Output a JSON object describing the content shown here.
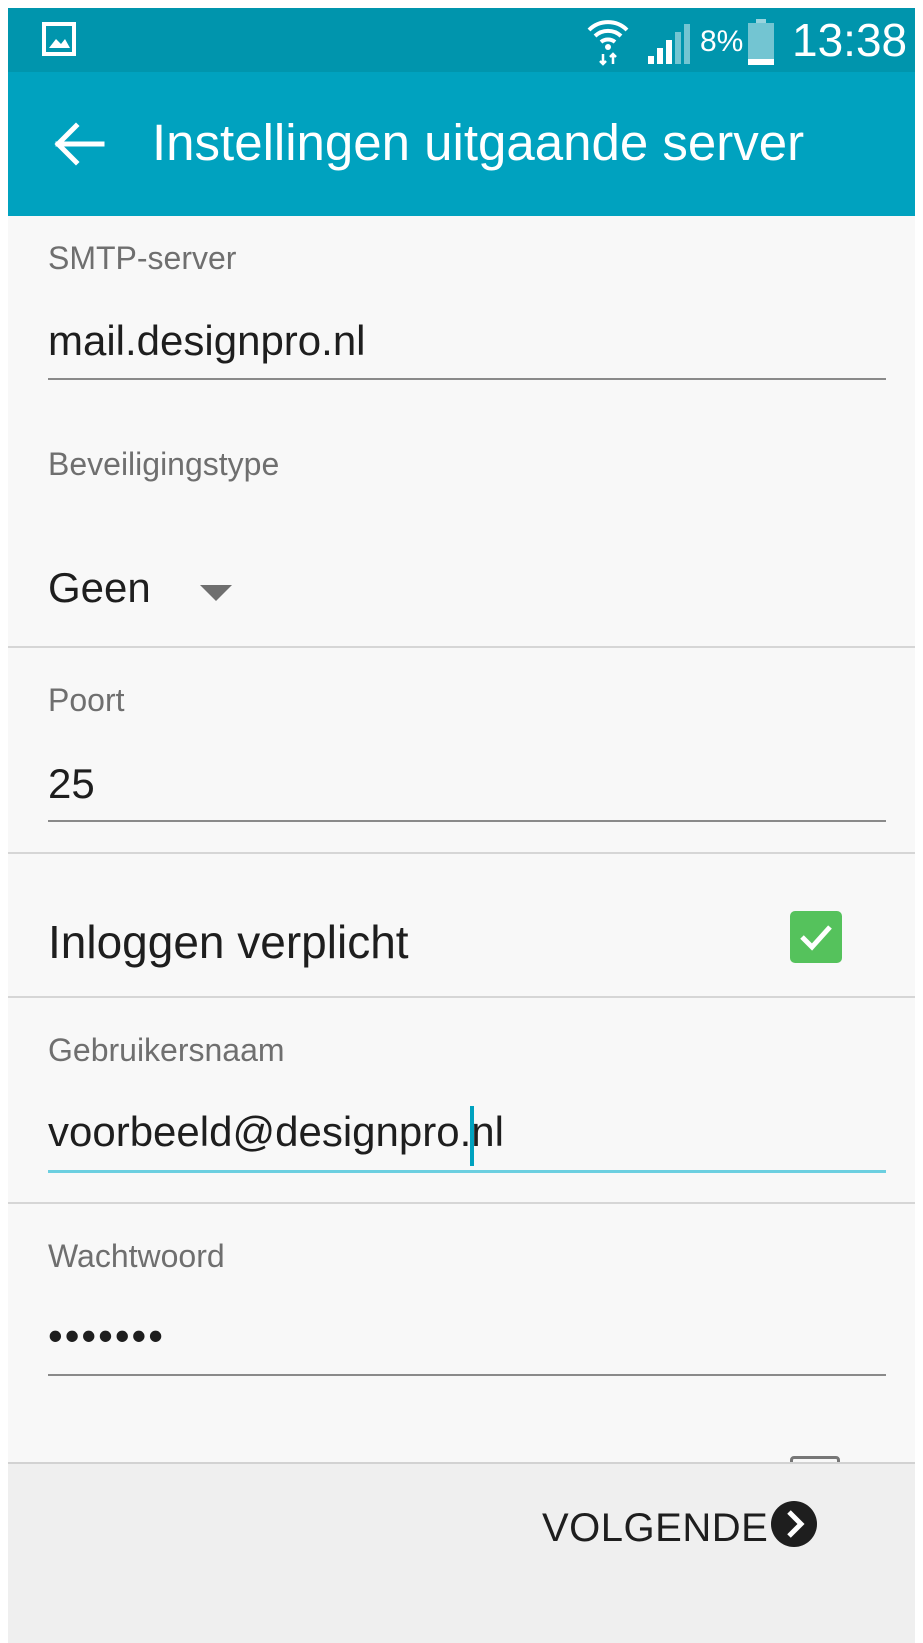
{
  "status_bar": {
    "battery_percent": "8%",
    "time": "13:38",
    "icons": [
      "gallery-icon",
      "wifi-icon",
      "signal-icon",
      "battery-icon"
    ]
  },
  "app_bar": {
    "title": "Instellingen uitgaande server",
    "back_icon": "arrow-left-icon"
  },
  "form": {
    "smtp_server": {
      "label": "SMTP-server",
      "value": "mail.designpro.nl"
    },
    "security_type": {
      "label": "Beveiligingstype",
      "value": "Geen"
    },
    "port": {
      "label": "Poort",
      "value": "25"
    },
    "login_required": {
      "label": "Inloggen verplicht",
      "checked": true
    },
    "username": {
      "label": "Gebruikersnaam",
      "value": "voorbeeld@designpro.nl"
    },
    "password": {
      "label": "Wachtwoord",
      "value": "•••••••"
    }
  },
  "bottom_bar": {
    "next_label": "VOLGENDE",
    "next_icon": "chevron-right-circle-icon"
  },
  "colors": {
    "status_bar": "#0095ad",
    "app_bar": "#00a2bf",
    "checkbox": "#55c25c",
    "focus_underline": "#6ccfe0"
  }
}
